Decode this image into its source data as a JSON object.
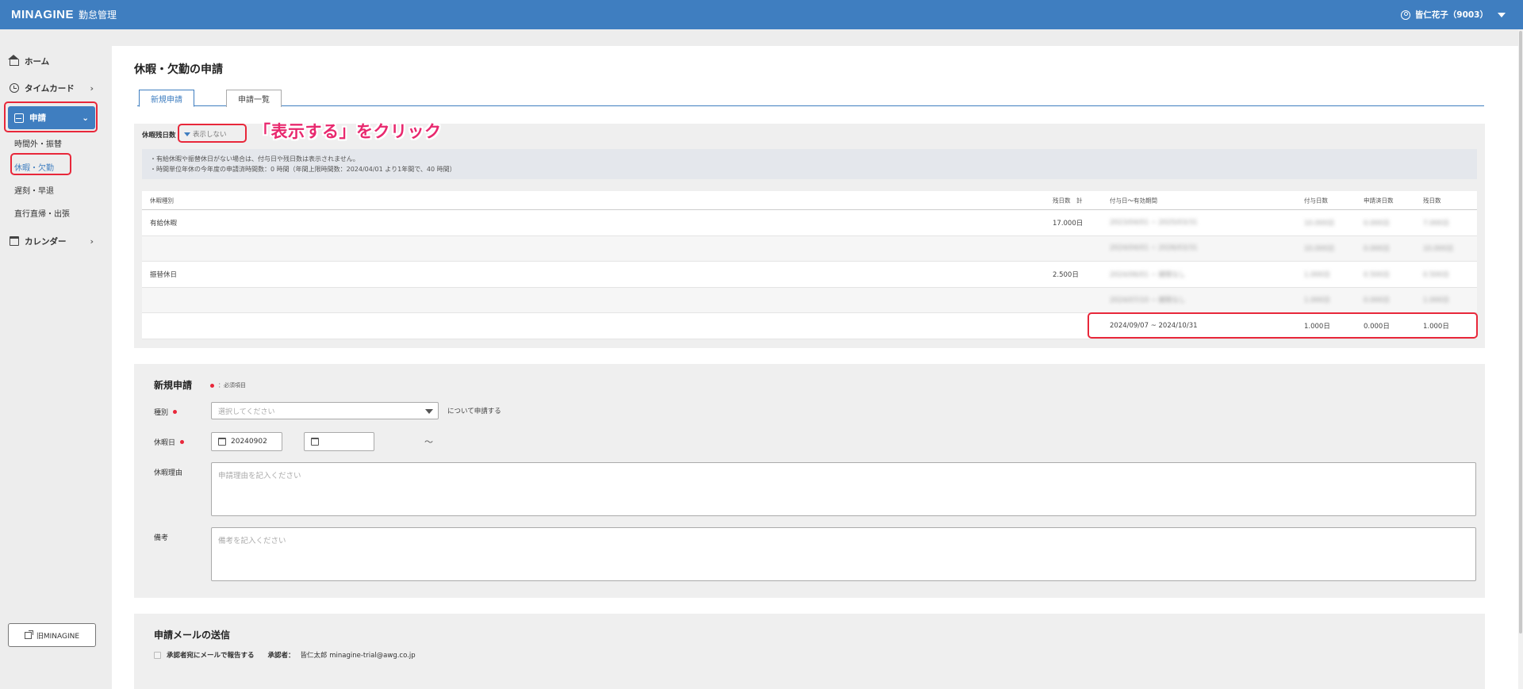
{
  "header": {
    "logo": "MINAGINE",
    "app_name": "勤怠管理",
    "user": "皆仁花子（9003）"
  },
  "sidebar": {
    "home": "ホーム",
    "timecard": "タイムカード",
    "request": "申請",
    "sub_items": [
      "時間外・振替",
      "休暇・欠勤",
      "遅刻・早退",
      "直行直帰・出張"
    ],
    "calendar": "カレンダー",
    "old_link": "旧MINAGINE"
  },
  "page": {
    "title": "休暇・欠勤の申請",
    "tabs": [
      "新規申請",
      "申請一覧"
    ]
  },
  "remaining": {
    "label": "休暇残日数",
    "toggle": "表示しない",
    "annotation": "「表示する」をクリック",
    "notes": [
      "・有給休暇や振替休日がない場合は、付与日や残日数は表示されません。",
      "・時間単位年休の今年度の申請済時間数：0 時間（年間上限時間数：2024/04/01 より1年間で、40 時間）"
    ],
    "table": {
      "headers": [
        "休暇種別",
        "残日数　計",
        "付与日〜有効期間",
        "付与日数",
        "申請済日数",
        "残日数"
      ],
      "rows": [
        {
          "type": "有給休暇",
          "total": "17.000日",
          "period": "2023/04/01 ~ 2025/03/31",
          "grant": "10.000日",
          "used": "0.000日",
          "remain": "7.000日"
        },
        {
          "type": "",
          "total": "",
          "period": "2024/04/01 ~ 2026/03/31",
          "grant": "10.000日",
          "used": "0.000日",
          "remain": "10.000日"
        },
        {
          "type": "振替休日",
          "total": "2.500日",
          "period": "2024/06/01 ~ 期限なし",
          "grant": "1.000日",
          "used": "0.500日",
          "remain": "0.500日"
        },
        {
          "type": "",
          "total": "",
          "period": "2024/07/10 ~ 期限なし",
          "grant": "1.000日",
          "used": "0.000日",
          "remain": "1.000日"
        },
        {
          "type": "",
          "total": "",
          "period": "2024/09/07 ~ 2024/10/31",
          "grant": "1.000日",
          "used": "0.000日",
          "remain": "1.000日"
        }
      ]
    }
  },
  "form": {
    "title": "新規申請",
    "required_note": "：必須項目",
    "type_label": "種別",
    "type_placeholder": "選択してください",
    "type_suffix": "について申請する",
    "date_label": "休暇日",
    "date_from": "20240902",
    "date_to": "",
    "date_sep": "〜",
    "reason_label": "休暇理由",
    "reason_placeholder": "申請理由を記入ください",
    "note_label": "備考",
    "note_placeholder": "備考を記入ください"
  },
  "mail": {
    "title": "申請メールの送信",
    "checkbox_label": "承認者宛にメールで報告する",
    "approver_label": "承認者：",
    "approver": "皆仁太郎 minagine-trial@awg.co.jp"
  },
  "colors": {
    "primary": "#3f7ec0",
    "highlight": "#e8273a",
    "annotation": "#e8286e"
  }
}
